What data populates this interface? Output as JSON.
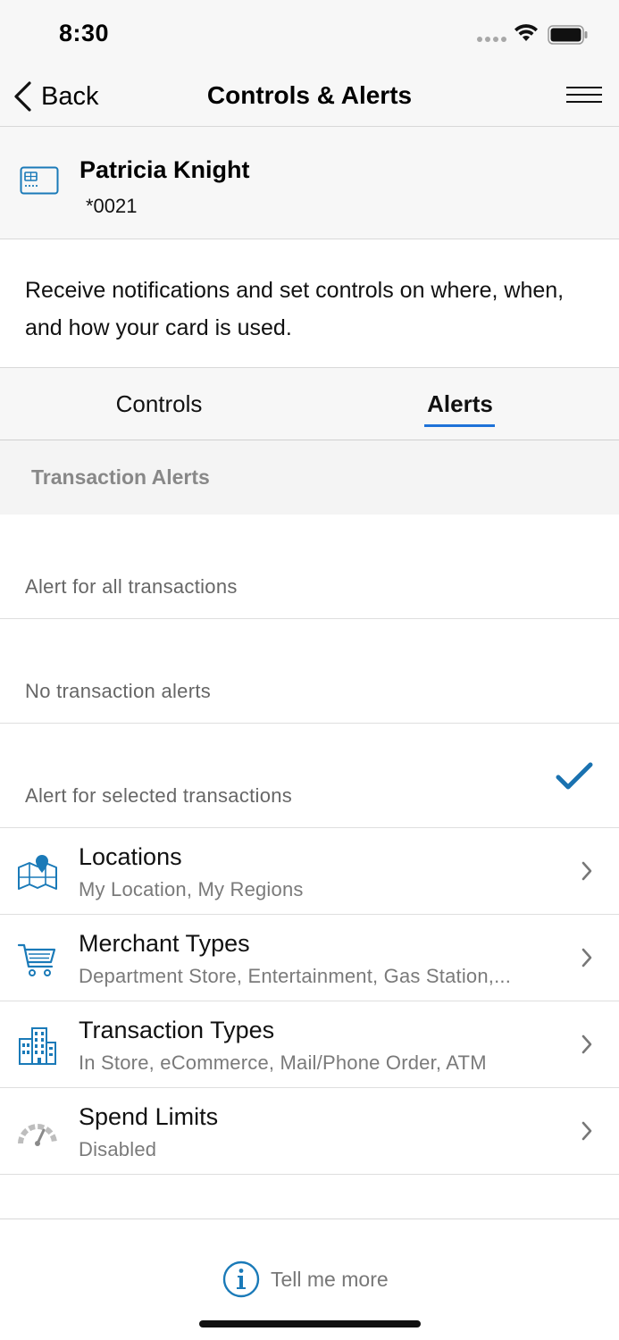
{
  "status_bar": {
    "time": "8:30"
  },
  "nav": {
    "back_label": "Back",
    "title": "Controls & Alerts"
  },
  "card": {
    "holder_name": "Patricia Knight",
    "number": "*0021"
  },
  "description": "Receive notifications and set controls on where, when, and how your card is used.",
  "tabs": [
    {
      "label": "Controls",
      "selected": false
    },
    {
      "label": "Alerts",
      "selected": true
    }
  ],
  "section_header": "Transaction Alerts",
  "options": [
    {
      "label": "Alert for all transactions",
      "checked": false
    },
    {
      "label": "No transaction alerts",
      "checked": false
    },
    {
      "label": "Alert for selected transactions",
      "checked": true
    }
  ],
  "rows": [
    {
      "title": "Locations",
      "subtitle": "My Location, My Regions",
      "icon": "map-pin-icon"
    },
    {
      "title": "Merchant Types",
      "subtitle": "Department Store, Entertainment, Gas Station,...",
      "icon": "shopping-cart-icon"
    },
    {
      "title": "Transaction Types",
      "subtitle": "In Store, eCommerce, Mail/Phone Order, ATM",
      "icon": "buildings-icon"
    },
    {
      "title": "Spend Limits",
      "subtitle": "Disabled",
      "icon": "speedometer-icon"
    }
  ],
  "footer": {
    "tell_more_label": "Tell me more"
  },
  "colors": {
    "accent": "#1e72d8",
    "icon_blue": "#1a7ab8",
    "check": "#1a72b0"
  }
}
